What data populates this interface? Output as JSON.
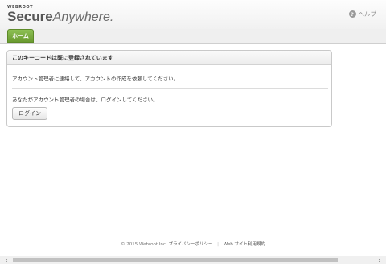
{
  "header": {
    "logo_small": "WEBROOT",
    "logo_secure": "Secure",
    "logo_anywhere": "Anywhere.",
    "help_icon": "?",
    "help_label": "ヘルプ"
  },
  "nav": {
    "home_tab": "ホーム"
  },
  "panel": {
    "title": "このキーコードは既に登録されています",
    "message1": "アカウント管理者に連絡して、アカウントの作成を依頼してください。",
    "message2": "あなたがアカウント管理者の場合は、ログインしてください。",
    "login_button": "ログイン"
  },
  "footer": {
    "copyright": "© 2015 Webroot Inc.",
    "privacy": "プライバシーポリシー",
    "separator": "|",
    "terms": "Web サイト利用規約"
  },
  "scrollbar": {
    "left_arrow": "‹",
    "right_arrow": "›"
  },
  "colors": {
    "accent": "#7cb342"
  }
}
